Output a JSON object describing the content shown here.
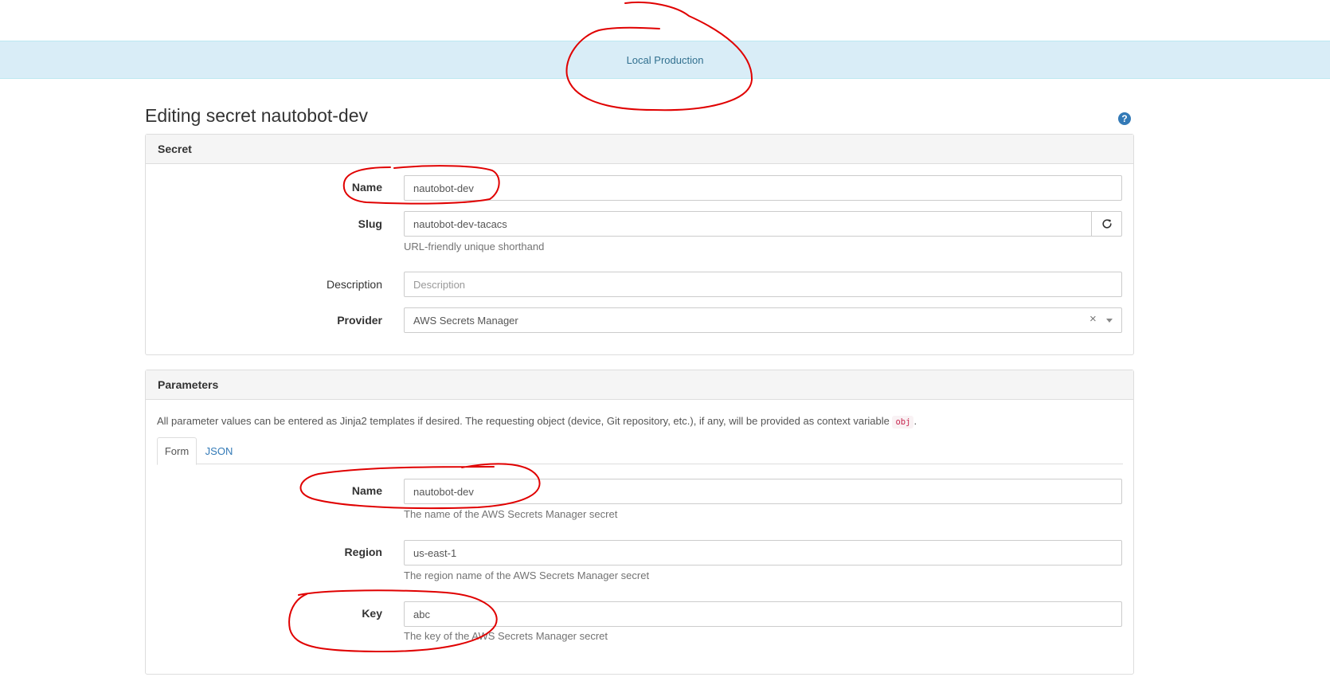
{
  "banner": {
    "text": "Local Production"
  },
  "page": {
    "title": "Editing secret nautobot-dev",
    "help_glyph": "?"
  },
  "secret_panel": {
    "heading": "Secret",
    "name_label": "Name",
    "name_value": "nautobot-dev",
    "slug_label": "Slug",
    "slug_value": "nautobot-dev-tacacs",
    "slug_help": "URL-friendly unique shorthand",
    "description_label": "Description",
    "description_placeholder": "Description",
    "provider_label": "Provider",
    "provider_value": "AWS Secrets Manager",
    "provider_clear": "×"
  },
  "parameters_panel": {
    "heading": "Parameters",
    "intro_text": "All parameter values can be entered as Jinja2 templates if desired. The requesting object (device, Git repository, etc.), if any, will be provided as context variable",
    "intro_code": "obj",
    "intro_end": ".",
    "tabs": [
      {
        "label": "Form",
        "active": true
      },
      {
        "label": "JSON",
        "active": false
      }
    ],
    "name_label": "Name",
    "name_value": "nautobot-dev",
    "name_help": "The name of the AWS Secrets Manager secret",
    "region_label": "Region",
    "region_value": "us-east-1",
    "region_help": "The region name of the AWS Secrets Manager secret",
    "key_label": "Key",
    "key_value": "abc",
    "key_help": "The key of the AWS Secrets Manager secret"
  },
  "icons": {
    "help": "question-circle-icon",
    "refresh": "refresh-icon",
    "clear": "close-icon",
    "caret": "chevron-down-icon"
  },
  "colors": {
    "banner_bg": "#d9edf7",
    "banner_text": "#31708f",
    "link": "#337ab7",
    "annotation": "#e00000"
  }
}
